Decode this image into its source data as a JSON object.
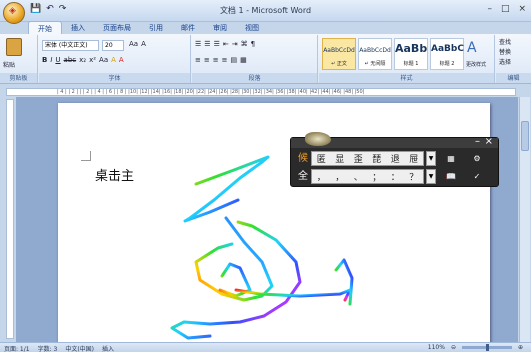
{
  "window": {
    "title": "文档 1 - Microsoft Word",
    "quick_access": [
      "💾",
      "↶",
      "↷"
    ],
    "controls": {
      "minimize": "–",
      "maximize": "□",
      "close": "×"
    }
  },
  "tabs": [
    "开始",
    "插入",
    "页面布局",
    "引用",
    "邮件",
    "审阅",
    "视图"
  ],
  "ribbon": {
    "clipboard": {
      "label": "剪贴板",
      "paste": "粘贴"
    },
    "font": {
      "label": "字体",
      "name": "宋体 (中文正文)",
      "size": "20",
      "row1": [
        "B",
        "I",
        "U",
        "abc",
        "x₂",
        "x²",
        "Aa"
      ],
      "row2": [
        "A",
        "A",
        "Aa",
        "A"
      ]
    },
    "paragraph": {
      "label": "段落",
      "row1": [
        "☰",
        "☰",
        "☰",
        "⇤",
        "⇥",
        "⌘",
        "¶"
      ],
      "row2": [
        "≡",
        "≡",
        "≡",
        "≡",
        "▤",
        "▦"
      ]
    },
    "styles": {
      "label": "样式",
      "items": [
        {
          "sample": "AaBbCcDd",
          "name": "↵ 正文"
        },
        {
          "sample": "AaBbCcDd",
          "name": "↵ 无间隔"
        },
        {
          "sample": "AaBb",
          "name": "标题 1"
        },
        {
          "sample": "AaBbC",
          "name": "标题 2"
        }
      ],
      "change": "更改样式"
    },
    "editing": {
      "label": "编辑",
      "find": "查找",
      "replace": "替换",
      "select": "选择"
    }
  },
  "ruler": {
    "marks": "| 4 |  | 2 |  |  | 2 |  | 4 |  | 6 |  | 8 |  |10|  |12|  |14|  |16|  |18|  |20|  |22|  |24|  |26|  |28|  |30|  |32|  |34|  |36|  |38|  |40|  |42|  |44|  |46|  |48|  |50|"
  },
  "document": {
    "text": "桌击主"
  },
  "ime": {
    "mode_top": "候",
    "mode_bottom": "全",
    "candidates": [
      "匿",
      "显",
      "歪",
      "琵",
      "退",
      "屉"
    ],
    "punct": [
      "，",
      "，",
      "、",
      "；",
      "：",
      "？"
    ],
    "buttons_top": [
      "▦",
      "⚙"
    ],
    "buttons_bottom": [
      "📖",
      "✓"
    ]
  },
  "status": {
    "page": "页面: 1/1",
    "words": "字数: 3",
    "lang": "中文(中国)",
    "mode": "插入",
    "zoom": "110%"
  }
}
